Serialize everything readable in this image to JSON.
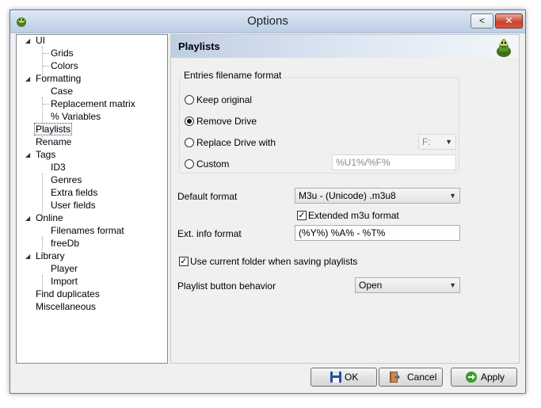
{
  "window": {
    "title": "Options",
    "help_button": "<",
    "close_button": "✕"
  },
  "tree": {
    "items": [
      {
        "label": "UI",
        "level": 0,
        "expanded": true
      },
      {
        "label": "Grids",
        "level": 1
      },
      {
        "label": "Colors",
        "level": 1
      },
      {
        "label": "Formatting",
        "level": 0,
        "expanded": true
      },
      {
        "label": "Case",
        "level": 1
      },
      {
        "label": "Replacement matrix",
        "level": 1
      },
      {
        "label": "% Variables",
        "level": 1
      },
      {
        "label": "Playlists",
        "level": 0,
        "selected": true
      },
      {
        "label": "Rename",
        "level": 0
      },
      {
        "label": "Tags",
        "level": 0,
        "expanded": true
      },
      {
        "label": "ID3",
        "level": 1
      },
      {
        "label": "Genres",
        "level": 1
      },
      {
        "label": "Extra fields",
        "level": 1
      },
      {
        "label": "User fields",
        "level": 1
      },
      {
        "label": "Online",
        "level": 0,
        "expanded": true
      },
      {
        "label": "Filenames format",
        "level": 1
      },
      {
        "label": "freeDb",
        "level": 1
      },
      {
        "label": "Library",
        "level": 0,
        "expanded": true
      },
      {
        "label": "Player",
        "level": 1
      },
      {
        "label": "Import",
        "level": 1
      },
      {
        "label": "Find duplicates",
        "level": 0
      },
      {
        "label": "Miscellaneous",
        "level": 0
      }
    ]
  },
  "panel": {
    "title": "Playlists",
    "entries_group": {
      "legend": "Entries filename format",
      "keep_original": "Keep original",
      "remove_drive": "Remove Drive",
      "replace_drive": "Replace Drive with",
      "drive_value": "F:",
      "custom": "Custom",
      "custom_value": "%U1%/%F%",
      "selected": "remove_drive"
    },
    "default_format_label": "Default format",
    "default_format_value": "M3u - (Unicode) .m3u8",
    "extended_m3u_label": "Extended m3u format",
    "extended_m3u_checked": true,
    "ext_info_label": "Ext. info format",
    "ext_info_value": "(%Y%) %A% - %T%",
    "use_current_folder_label": "Use current folder when saving playlists",
    "use_current_folder_checked": true,
    "playlist_button_label": "Playlist button behavior",
    "playlist_button_value": "Open"
  },
  "footer": {
    "ok": "OK",
    "cancel": "Cancel",
    "apply": "Apply"
  }
}
